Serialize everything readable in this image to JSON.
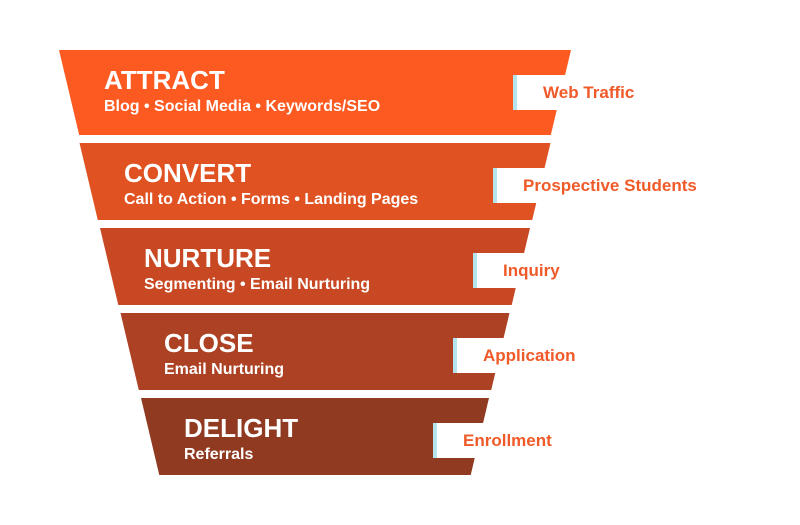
{
  "funnel": {
    "label_color": "#F05A28",
    "notch_accent": "#B4E4EC",
    "stages": [
      {
        "title": "ATTRACT",
        "items": "Blog • Social Media • Keywords/SEO",
        "label": "Web Traffic",
        "color": "#FD5A22"
      },
      {
        "title": "CONVERT",
        "items": "Call to Action • Forms • Landing Pages",
        "label": "Prospective Students",
        "color": "#E15222"
      },
      {
        "title": "NURTURE",
        "items": "Segmenting • Email Nurturing",
        "label": "Inquiry",
        "color": "#C84823"
      },
      {
        "title": "CLOSE",
        "items": "Email Nurturing",
        "label": "Application",
        "color": "#AD4123"
      },
      {
        "title": "DELIGHT",
        "items": "Referrals",
        "label": "Enrollment",
        "color": "#8F3A21"
      }
    ]
  }
}
